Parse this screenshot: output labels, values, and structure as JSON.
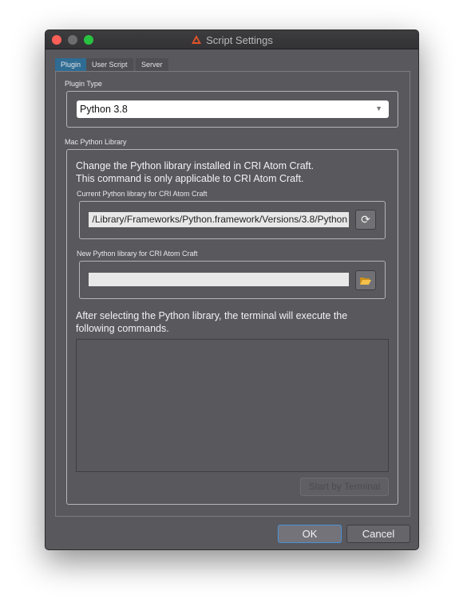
{
  "window": {
    "title": "Script Settings"
  },
  "tabs": [
    {
      "label": "Plugin",
      "active": true
    },
    {
      "label": "User Script"
    },
    {
      "label": "Server"
    }
  ],
  "plugin_type": {
    "label": "Plugin Type",
    "selected": "Python 3.8"
  },
  "mac_python": {
    "label": "Mac Python Library",
    "description_line1": "Change the Python library installed in CRI Atom Craft.",
    "description_line2": "This command is only applicable to CRI Atom Craft.",
    "current_label": "Current Python library for CRI Atom Craft",
    "current_value": "/Library/Frameworks/Python.framework/Versions/3.8/Python",
    "new_label": "New Python library for CRI Atom Craft",
    "new_value": "",
    "after_line1": "After selecting the Python library, the terminal will execute the",
    "after_line2": "following commands.",
    "commands": "",
    "start_button": "Start by Terminal"
  },
  "buttons": {
    "ok": "OK",
    "cancel": "Cancel"
  },
  "colors": {
    "accent": "#2f6c94",
    "close": "#fc5f57",
    "minimize": "#6d6d6f",
    "zoom": "#29c240"
  }
}
